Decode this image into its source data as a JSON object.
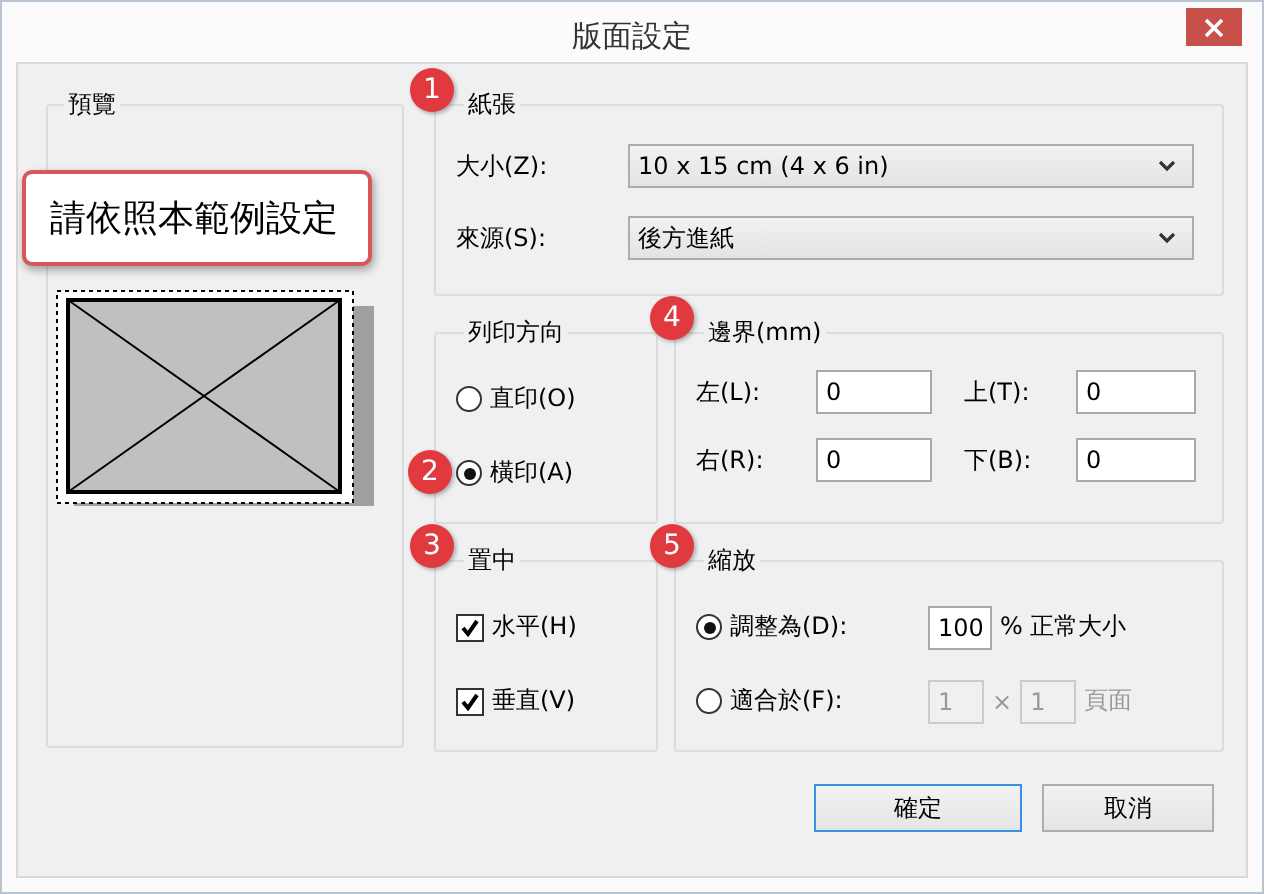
{
  "window": {
    "title": "版面設定"
  },
  "callout": "請依照本範例設定",
  "preview": {
    "label": "預覽"
  },
  "paper": {
    "badge": "1",
    "label": "紙張",
    "fields": [
      {
        "label": "大小(Z):",
        "value": "10 x 15 cm (4 x 6 in)"
      },
      {
        "label": "來源(S):",
        "value": "後方進紙"
      }
    ]
  },
  "orientation": {
    "label": "列印方向",
    "options": [
      {
        "label": "直印(O)",
        "selected": false
      },
      {
        "label": "橫印(A)",
        "selected": true,
        "badge": "2"
      }
    ]
  },
  "margins": {
    "badge": "4",
    "label": "邊界(mm)",
    "fields": [
      {
        "label": "左(L):",
        "value": "0"
      },
      {
        "label": "上(T):",
        "value": "0"
      },
      {
        "label": "右(R):",
        "value": "0"
      },
      {
        "label": "下(B):",
        "value": "0"
      }
    ]
  },
  "center": {
    "badge": "3",
    "label": "置中",
    "options": [
      {
        "label": "水平(H)",
        "checked": true
      },
      {
        "label": "垂直(V)",
        "checked": true
      }
    ]
  },
  "scale": {
    "badge": "5",
    "label": "縮放",
    "options": [
      {
        "kind": "percent",
        "label": "調整為(D):",
        "selected": true,
        "value": "100",
        "suffix": "% 正常大小"
      },
      {
        "kind": "fit",
        "label": "適合於(F):",
        "selected": false,
        "disabled": true,
        "wide": "1",
        "times": "×",
        "tall": "1",
        "suffix": "頁面"
      }
    ]
  },
  "buttons": [
    {
      "label": "確定",
      "default": true
    },
    {
      "label": "取消",
      "default": false
    }
  ]
}
